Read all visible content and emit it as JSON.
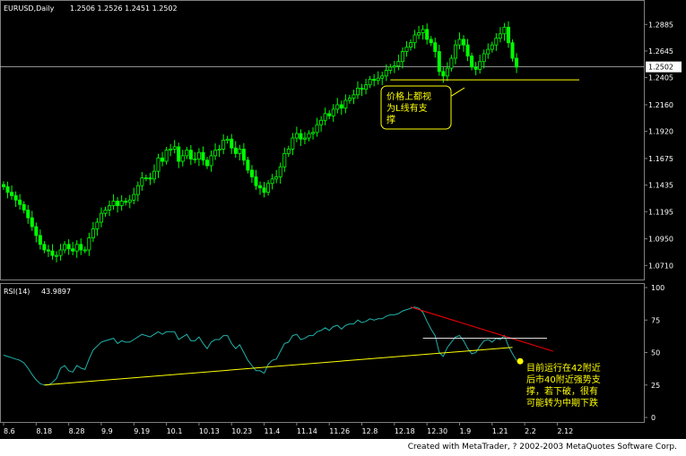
{
  "header": {
    "symbol_label": "EURUSD,Daily",
    "ohlc_label": "1.2506 1.2526 1.2451 1.2502"
  },
  "footer": {
    "credit": "Created with MetaTrader, ? 2002-2003 MetaQuotes Software Corp."
  },
  "annotations": {
    "price_note": [
      "价格上都视",
      "为L线有支",
      "撑"
    ],
    "rsi_note": [
      "目前运行在42附近",
      "后市40附近强势支",
      "撑，若下破，很有",
      "可能转为中期下跌"
    ]
  },
  "colors": {
    "background": "#000000",
    "candle": "#00ff00",
    "rsi_line": "#20b2aa",
    "support_line": "#ffff00",
    "resistance_line": "#ff0000",
    "current_price_line": "#c0c0c0",
    "grid_axis": "#808080"
  },
  "chart_data": [
    {
      "type": "candlestick",
      "symbol": "EURUSD",
      "timeframe": "Daily",
      "ohlc_last": {
        "open": 1.2506,
        "high": 1.2526,
        "low": 1.2451,
        "close": 1.2502
      },
      "current_price_label": "1.2502",
      "y_ticks": [
        1.2885,
        1.2645,
        1.2405,
        1.216,
        1.192,
        1.1675,
        1.1435,
        1.1195,
        1.095,
        1.071
      ],
      "y_tick_labels": [
        "1.2885",
        "1.2645",
        "1.2405",
        "1.2160",
        "1.1920",
        "1.1675",
        "1.1435",
        "1.1195",
        "1.0950",
        "1.0710"
      ],
      "ylim": [
        1.068,
        1.296
      ],
      "x_tick_labels": [
        "8.6",
        "8.18",
        "8.28",
        "9.9",
        "9.19",
        "10.1",
        "10.13",
        "10.23",
        "11.4",
        "11.14",
        "11.26",
        "12.8",
        "12.18",
        "12.30",
        "1.9",
        "1.21",
        "2.2",
        "2.12"
      ],
      "bars_per_tick": 8,
      "closes": [
        1.142,
        1.137,
        1.134,
        1.13,
        1.126,
        1.121,
        1.114,
        1.106,
        1.098,
        1.09,
        1.085,
        1.084,
        1.08,
        1.08,
        1.085,
        1.09,
        1.086,
        1.084,
        1.09,
        1.085,
        1.085,
        1.096,
        1.104,
        1.11,
        1.118,
        1.121,
        1.125,
        1.129,
        1.125,
        1.129,
        1.128,
        1.13,
        1.135,
        1.143,
        1.15,
        1.15,
        1.149,
        1.156,
        1.168,
        1.165,
        1.175,
        1.176,
        1.178,
        1.165,
        1.17,
        1.175,
        1.167,
        1.167,
        1.173,
        1.166,
        1.161,
        1.17,
        1.175,
        1.176,
        1.184,
        1.185,
        1.177,
        1.172,
        1.176,
        1.166,
        1.157,
        1.151,
        1.143,
        1.141,
        1.137,
        1.145,
        1.149,
        1.151,
        1.16,
        1.172,
        1.176,
        1.186,
        1.19,
        1.185,
        1.186,
        1.19,
        1.191,
        1.198,
        1.202,
        1.208,
        1.206,
        1.212,
        1.216,
        1.213,
        1.22,
        1.222,
        1.225,
        1.231,
        1.23,
        1.234,
        1.239,
        1.238,
        1.24,
        1.242,
        1.247,
        1.25,
        1.251,
        1.255,
        1.264,
        1.268,
        1.272,
        1.279,
        1.281,
        1.284,
        1.275,
        1.272,
        1.264,
        1.246,
        1.242,
        1.249,
        1.258,
        1.27,
        1.275,
        1.27,
        1.26,
        1.25,
        1.248,
        1.255,
        1.262,
        1.266,
        1.27,
        1.276,
        1.28,
        1.286,
        1.272,
        1.258,
        1.25
      ],
      "support_level": 1.2385,
      "annotation": "价格上都视为L线有支撑"
    },
    {
      "type": "line",
      "name": "RSI(14)",
      "title": "RSI(14)",
      "current_value": 43.9897,
      "ylim": [
        0,
        100
      ],
      "y_ticks": [
        100,
        75,
        50,
        25,
        0
      ],
      "values": [
        48,
        47,
        46,
        45,
        44,
        42,
        38,
        33,
        29,
        26,
        25,
        25,
        27,
        30,
        38,
        40,
        36,
        35,
        40,
        38,
        37,
        45,
        52,
        55,
        58,
        59,
        60,
        61,
        57,
        59,
        58,
        58,
        60,
        62,
        64,
        63,
        62,
        64,
        66,
        64,
        66,
        66,
        66,
        60,
        62,
        64,
        59,
        59,
        62,
        57,
        53,
        58,
        60,
        60,
        63,
        63,
        57,
        53,
        56,
        50,
        44,
        40,
        36,
        36,
        34,
        41,
        44,
        45,
        51,
        57,
        58,
        63,
        64,
        60,
        61,
        63,
        63,
        66,
        67,
        69,
        67,
        70,
        71,
        68,
        71,
        72,
        72,
        75,
        73,
        74,
        76,
        75,
        76,
        76,
        78,
        79,
        79,
        80,
        82,
        83,
        84,
        85,
        84,
        81,
        74,
        68,
        63,
        50,
        47,
        54,
        58,
        62,
        63,
        59,
        53,
        49,
        50,
        55,
        59,
        60,
        58,
        61,
        60,
        63,
        55,
        49,
        44
      ],
      "support_trendline": {
        "from": {
          "bar": 10,
          "value": 25
        },
        "to": {
          "bar": 125,
          "value": 54
        }
      },
      "resistance_trendline": {
        "from": {
          "bar": 100,
          "value": 85
        },
        "to": {
          "bar": 135,
          "value": 51
        }
      },
      "horizontal_line": 61,
      "annotation": "目前运行在42附近后市40附近强势支撑，若下破，很有可能转为中期下跌"
    }
  ]
}
